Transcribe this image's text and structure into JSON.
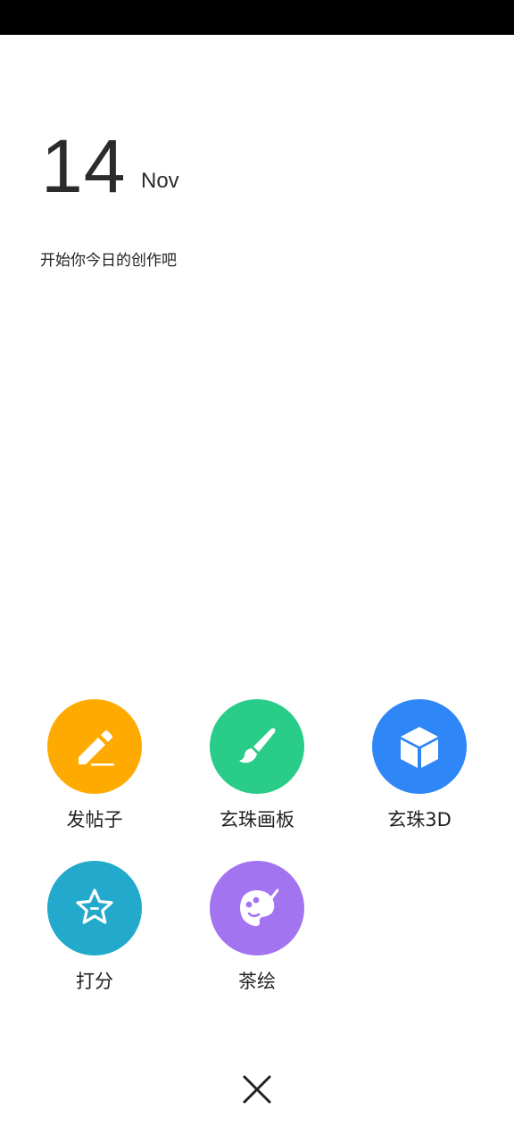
{
  "header": {
    "day": "14",
    "month": "Nov",
    "subtitle": "开始你今日的创作吧"
  },
  "actions": [
    {
      "label": "发帖子",
      "icon": "pencil-icon",
      "color": "#FFAA00"
    },
    {
      "label": "玄珠画板",
      "icon": "brush-icon",
      "color": "#29CC88"
    },
    {
      "label": "玄珠3D",
      "icon": "cube-icon",
      "color": "#2F86F6"
    },
    {
      "label": "打分",
      "icon": "star-icon",
      "color": "#22A9CC"
    },
    {
      "label": "茶绘",
      "icon": "palette-icon",
      "color": "#A374F0"
    }
  ],
  "close": {
    "icon": "close-icon"
  }
}
